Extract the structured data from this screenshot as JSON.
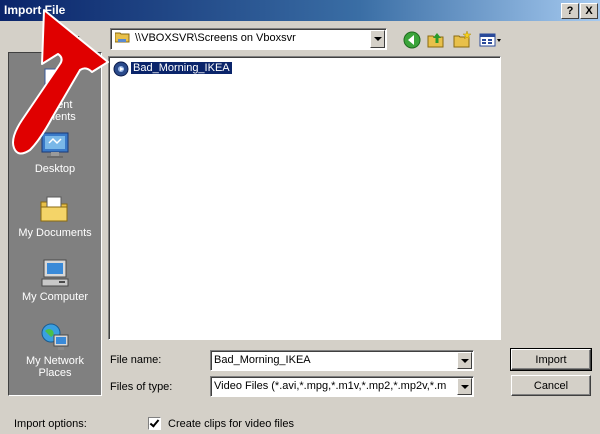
{
  "window": {
    "title": "Import File",
    "help_button": "?",
    "close_button": "X"
  },
  "lookin": {
    "label": "k in:",
    "value": "\\\\VBOXSVR\\Screens on Vboxsvr"
  },
  "places": [
    {
      "label_line1": "Recent",
      "label_line2": "cuments",
      "icon": "recent-documents-icon"
    },
    {
      "label_line1": "Desktop",
      "label_line2": "",
      "icon": "desktop-icon"
    },
    {
      "label_line1": "My Documents",
      "label_line2": "",
      "icon": "my-documents-icon"
    },
    {
      "label_line1": "My Computer",
      "label_line2": "",
      "icon": "my-computer-icon"
    },
    {
      "label_line1": "My Network",
      "label_line2": "Places",
      "icon": "my-network-places-icon"
    }
  ],
  "files": [
    {
      "name": "Bad_Morning_IKEA",
      "selected": true
    }
  ],
  "filename": {
    "label": "File name:",
    "value": "Bad_Morning_IKEA"
  },
  "filetype": {
    "label": "Files of type:",
    "value": "Video Files (*.avi,*.mpg,*.m1v,*.mp2,*.mp2v,*.m"
  },
  "buttons": {
    "import": "Import",
    "cancel": "Cancel"
  },
  "options": {
    "label": "Import options:",
    "create_clips": "Create clips for video files",
    "create_clips_checked": true
  },
  "colors": {
    "title_bar": "#0a246a",
    "selection": "#0a246a",
    "face": "#d4d0c8",
    "annotation_arrow": "#e00000"
  }
}
